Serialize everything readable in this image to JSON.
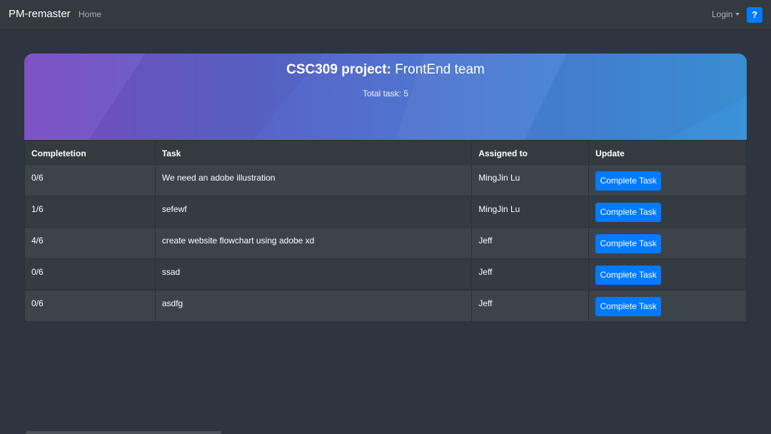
{
  "navbar": {
    "brand": "PM-remaster",
    "home": "Home",
    "login": "Login",
    "help": "?"
  },
  "banner": {
    "title_bold": "CSC309 project:",
    "title_rest": "FrontEnd team",
    "total_tasks": "Total task: 5"
  },
  "table": {
    "headers": [
      "Completetion",
      "Task",
      "Assigned to",
      "Update"
    ],
    "rows": [
      {
        "completion": "0/6",
        "task": "We need an adobe illustration",
        "assigned": "MingJin Lu",
        "action": "Complete Task"
      },
      {
        "completion": "1/6",
        "task": "sefewf",
        "assigned": "MingJin Lu",
        "action": "Complete Task"
      },
      {
        "completion": "4/6",
        "task": "create website flowchart using adobe xd",
        "assigned": "Jeff",
        "action": "Complete Task"
      },
      {
        "completion": "0/6",
        "task": "ssad",
        "assigned": "Jeff",
        "action": "Complete Task"
      },
      {
        "completion": "0/6",
        "task": "asdfg",
        "assigned": "Jeff",
        "action": "Complete Task"
      }
    ]
  },
  "colors": {
    "background": "#2d3540",
    "navbar": "#343a40",
    "primary_button": "#007bff",
    "banner_gradient_start": "#7b4cc2",
    "banner_gradient_end": "#3a92d8"
  }
}
